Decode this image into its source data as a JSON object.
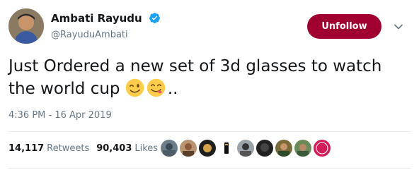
{
  "author": {
    "display_name": "Ambati Rayudu",
    "handle": "@RayuduAmbati",
    "verified": true
  },
  "actions": {
    "unfollow_label": "Unfollow"
  },
  "tweet": {
    "text": "Just Ordered a new set of 3d glasses to watch the world cup",
    "emojis": [
      "winking-face",
      "face-savoring-food"
    ],
    "trailing": "..",
    "timestamp": "4:36 PM - 16 Apr 2019"
  },
  "stats": {
    "retweets_count": "14,117",
    "retweets_label": "Retweets",
    "likes_count": "90,403",
    "likes_label": "Likes"
  },
  "colors": {
    "unfollow_bg": "#a0002f",
    "verified_blue": "#1da1f2",
    "muted_text": "#657786",
    "primary_text": "#14171a"
  }
}
